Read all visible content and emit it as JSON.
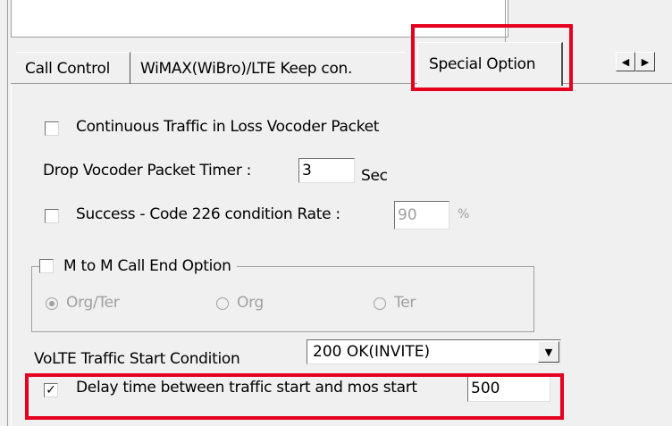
{
  "tabs": [
    {
      "label": "Call Control"
    },
    {
      "label": "WiMAX(WiBro)/LTE Keep con."
    },
    {
      "label": "Special Option"
    }
  ],
  "scroll_left_glyph": "◀",
  "scroll_right_glyph": "▶",
  "options": {
    "continuous_traffic": {
      "label": "Continuous Traffic in Loss Vocoder Packet",
      "checked": false
    },
    "drop_timer": {
      "label": "Drop Vocoder Packet Timer :",
      "value": "3",
      "unit": "Sec"
    },
    "success_code": {
      "label": "Success - Code 226 condition Rate :",
      "value": "90",
      "unit": "%",
      "checked": false
    },
    "m2m_group": {
      "label": "M to M Call End Option",
      "checked": false,
      "radios": [
        {
          "label": "Org/Ter",
          "selected": true
        },
        {
          "label": "Org",
          "selected": false
        },
        {
          "label": "Ter",
          "selected": false
        }
      ]
    },
    "volte_start": {
      "label": "VoLTE Traffic Start Condition",
      "value": "200 OK(INVITE)"
    },
    "delay_time": {
      "label": "Delay time between traffic start and mos start",
      "value": "500",
      "checked": true
    }
  },
  "colors": {
    "highlight": "#e6001f",
    "background": "#f0f0f0"
  }
}
